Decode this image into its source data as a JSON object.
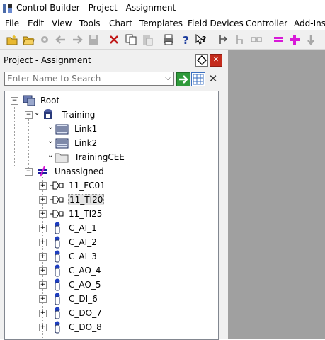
{
  "window": {
    "title": "Control Builder - Project - Assignment"
  },
  "menu": [
    "File",
    "Edit",
    "View",
    "Tools",
    "Chart",
    "Templates",
    "Field Devices",
    "Controller",
    "Add-Ins"
  ],
  "toolbar": {
    "icons": [
      "new-folder-icon",
      "open-folder-icon",
      "settings-icon",
      "back-arrow-icon",
      "forward-arrow-icon",
      "save-icon",
      "delete-icon",
      "copy-icon",
      "paste-icon",
      "print-icon",
      "help-icon",
      "context-help-icon",
      "assign-icon",
      "unassign-icon",
      "link-icon",
      "equals-icon",
      "add-icon",
      "down-arrow-icon"
    ]
  },
  "panel": {
    "title": "Project - Assignment",
    "search_placeholder": "Enter Name to Search"
  },
  "tree": {
    "root": "Root",
    "training": "Training",
    "link1": "Link1",
    "link2": "Link2",
    "training_cee": "TrainingCEE",
    "unassigned": "Unassigned",
    "items": [
      "11_FC01",
      "11_TI20",
      "11_TI25",
      "C_AI_1",
      "C_AI_2",
      "C_AI_3",
      "C_AO_4",
      "C_AO_5",
      "C_DI_6",
      "C_DO_7",
      "C_DO_8"
    ],
    "selected": "11_TI20"
  },
  "colors": {
    "accent_green": "#2e9a3a",
    "close_red": "#c42b1c",
    "workspace_gray": "#a0a0a0"
  }
}
